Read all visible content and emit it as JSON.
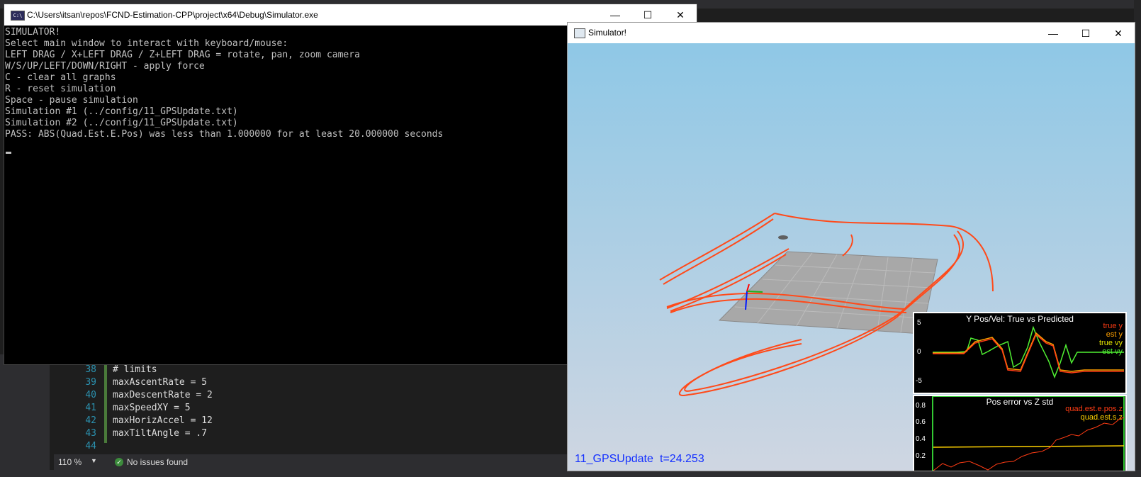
{
  "console": {
    "title": "C:\\Users\\itsan\\repos\\FCND-Estimation-CPP\\project\\x64\\Debug\\Simulator.exe",
    "icon": "console-app-icon",
    "lines": [
      "SIMULATOR!",
      "Select main window to interact with keyboard/mouse:",
      "LEFT DRAG / X+LEFT DRAG / Z+LEFT DRAG = rotate, pan, zoom camera",
      "W/S/UP/LEFT/DOWN/RIGHT - apply force",
      "C - clear all graphs",
      "R - reset simulation",
      "Space - pause simulation",
      "Simulation #1 (../config/11_GPSUpdate.txt)",
      "Simulation #2 (../config/11_GPSUpdate.txt)",
      "PASS: ABS(Quad.Est.E.Pos) was less than 1.000000 for at least 20.000000 seconds"
    ]
  },
  "editor": {
    "lines": [
      {
        "num": "38",
        "text": "# limits"
      },
      {
        "num": "39",
        "text": "maxAscentRate = 5"
      },
      {
        "num": "40",
        "text": "maxDescentRate = 2"
      },
      {
        "num": "41",
        "text": "maxSpeedXY = 5"
      },
      {
        "num": "42",
        "text": "maxHorizAccel = 12"
      },
      {
        "num": "43",
        "text": "maxTiltAngle = .7"
      },
      {
        "num": "44",
        "text": ""
      }
    ],
    "status": {
      "zoom": "110 %",
      "issues": "No issues found"
    }
  },
  "window_controls": {
    "minimize": "—",
    "maximize": "☐",
    "close": "✕"
  },
  "simulator": {
    "title": "Simulator!",
    "scenario": "11_GPSUpdate",
    "time": "t=24.253",
    "plot1": {
      "title": "Y Pos/Vel: True vs Predicted",
      "legend": [
        {
          "label": "true y",
          "color": "#ff3c14"
        },
        {
          "label": "est y",
          "color": "#ffa000"
        },
        {
          "label": "true vy",
          "color": "#e6e600"
        },
        {
          "label": "est vy",
          "color": "#50f032"
        }
      ],
      "ticks": [
        "5",
        "0",
        "-5"
      ]
    },
    "plot2": {
      "title": "Pos error vs Z std",
      "legend": [
        {
          "label": "quad.est.e.pos.z",
          "color": "#ff3c14"
        },
        {
          "label": "quad.est.s.z",
          "color": "#ffd200"
        }
      ],
      "ticks": [
        "0.8",
        "0.6",
        "0.4",
        "0.2"
      ]
    }
  },
  "colors": {
    "trail": "#ff4a1a",
    "ground": "#a8a8a8",
    "scenario_text": "#1430ff"
  }
}
